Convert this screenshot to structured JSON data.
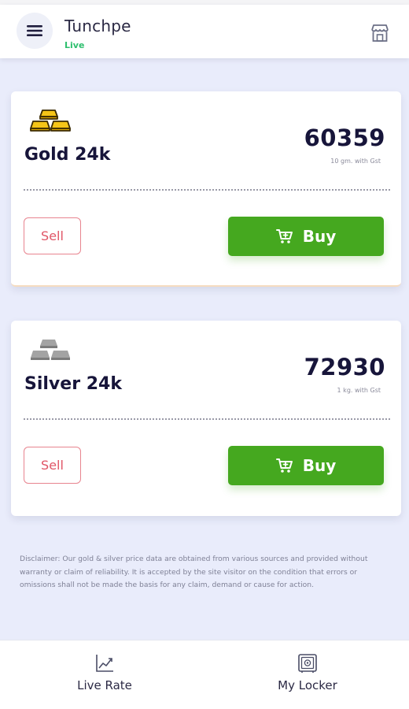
{
  "header": {
    "title": "Tunchpe",
    "status": "Live",
    "menu_icon": "hamburger-menu-icon",
    "store_icon": "store-icon"
  },
  "cards": [
    {
      "metal": "Gold 24k",
      "price": "60359",
      "unit": "10 gm. with Gst",
      "icon": "gold-bars-icon",
      "sell_label": "Sell",
      "buy_label": "Buy"
    },
    {
      "metal": "Silver 24k",
      "price": "72930",
      "unit": "1 kg. with Gst",
      "icon": "silver-bars-icon",
      "sell_label": "Sell",
      "buy_label": "Buy"
    }
  ],
  "disclaimer": "Disclaimer: Our gold & silver price data are obtained from various sources and provided without warranty or claim of reliability. It is accepted by the site visitor on the condition that errors or omissions shall not be made the basis for any claim, demand or cause for action.",
  "bottom_nav": [
    {
      "label": "Live Rate",
      "icon": "trend-chart-icon"
    },
    {
      "label": "My Locker",
      "icon": "safe-locker-icon"
    }
  ],
  "colors": {
    "accent_green": "#45a81f",
    "live_green": "#2ebf6e",
    "sell_red": "#e05566",
    "background": "#e9ecfb",
    "gold": "#f5c518",
    "silver": "#9e9e9e"
  }
}
